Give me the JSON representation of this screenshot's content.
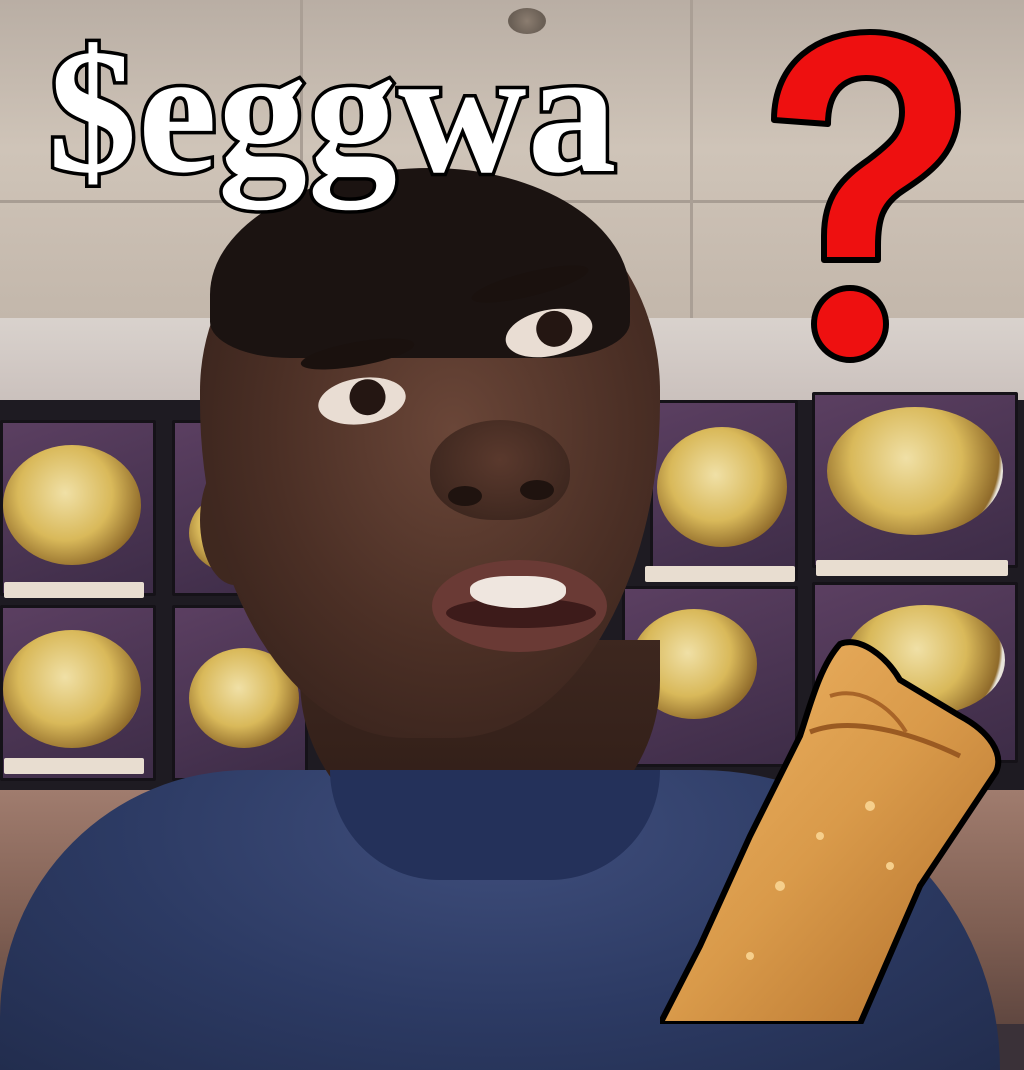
{
  "image": {
    "title_text": "$eggwa",
    "question_glyph": "?",
    "colors": {
      "title_fill": "#ffffff",
      "title_outline": "#000000",
      "question_fill": "#ee1010",
      "question_outline": "#000000",
      "shirt": "#2c3a63",
      "eggroll": "#d99a4a"
    }
  }
}
